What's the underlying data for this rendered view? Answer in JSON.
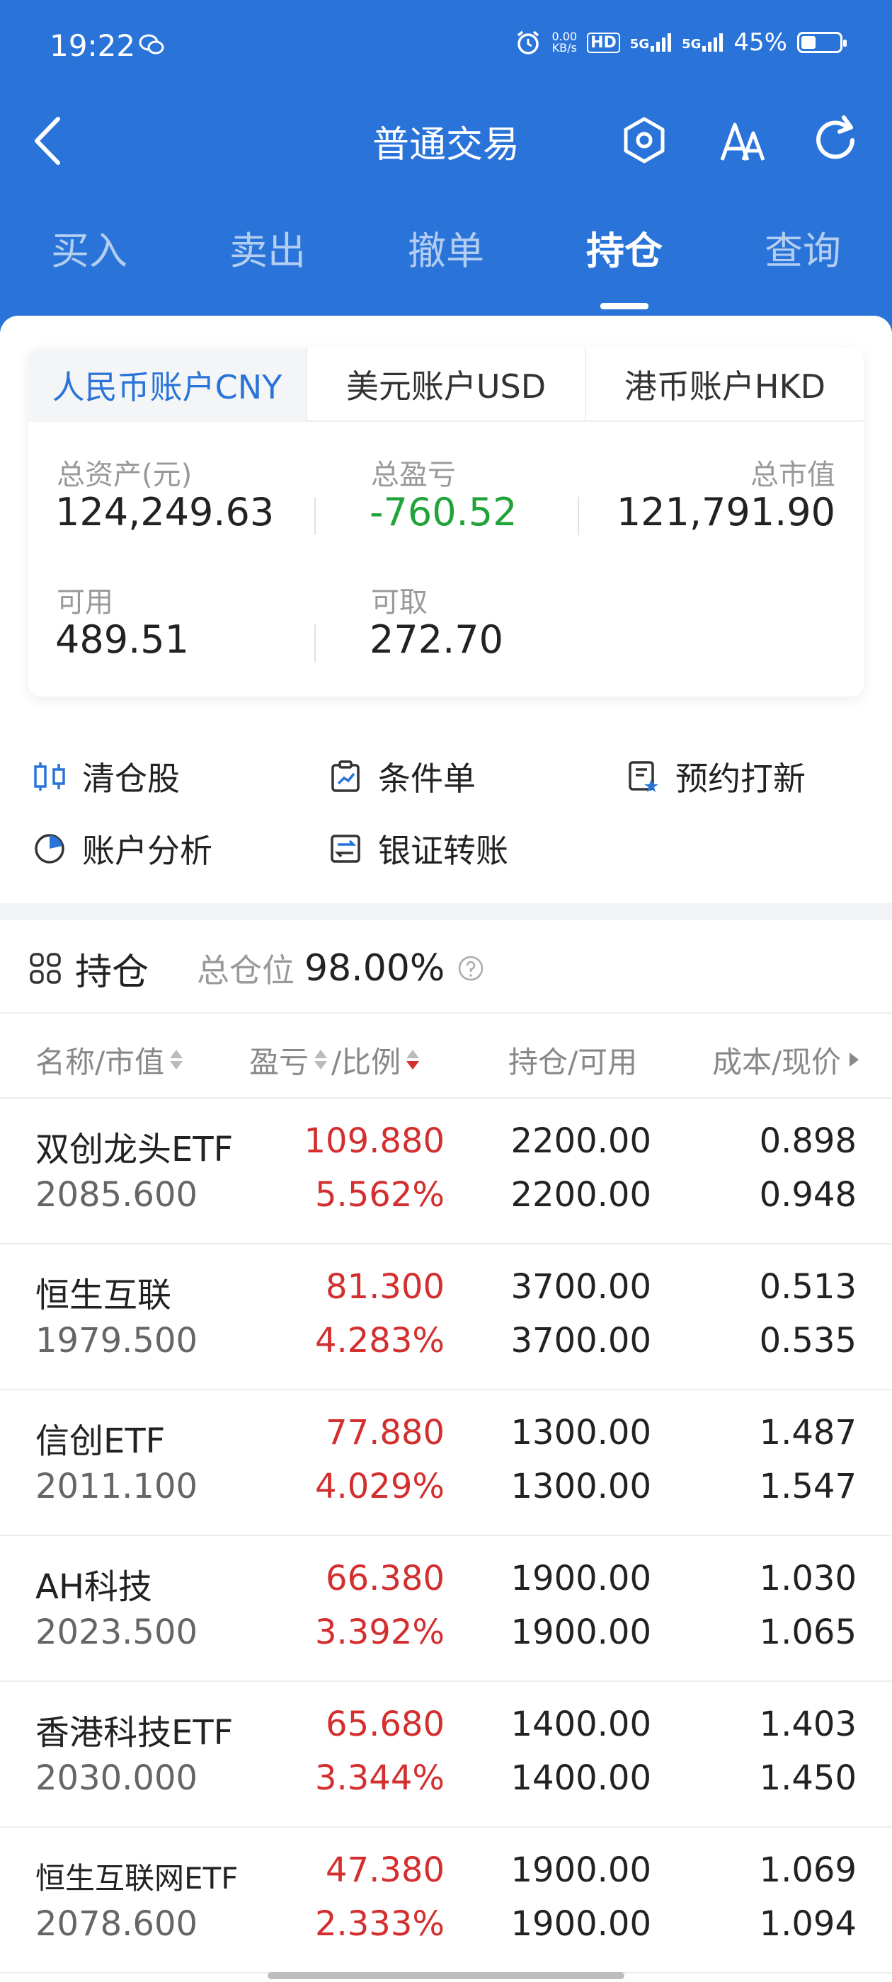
{
  "status_bar": {
    "time": "19:22",
    "net_speed_top": "0.00",
    "net_speed_unit": "KB/s",
    "hd_label": "HD",
    "signal_1": "5G",
    "signal_2": "5G",
    "battery": "45%",
    "battery_level": 0.45
  },
  "nav": {
    "title": "普通交易",
    "icons": [
      "back-chevron-icon",
      "settings-hexagon-icon",
      "font-size-icon",
      "refresh-icon"
    ]
  },
  "tabs": [
    {
      "label": "买入",
      "active": false
    },
    {
      "label": "卖出",
      "active": false
    },
    {
      "label": "撤单",
      "active": false
    },
    {
      "label": "持仓",
      "active": true
    },
    {
      "label": "查询",
      "active": false
    }
  ],
  "accounts": [
    {
      "label": "人民币账户CNY",
      "active": true
    },
    {
      "label": "美元账户USD",
      "active": false
    },
    {
      "label": "港币账户HKD",
      "active": false
    }
  ],
  "metrics": {
    "total_assets_label": "总资产(元)",
    "total_assets": "124,249.63",
    "total_pnl_label": "总盈亏",
    "total_pnl": "-760.52",
    "market_value_label": "总市值",
    "market_value": "121,791.90",
    "available_label": "可用",
    "available": "489.51",
    "withdrawable_label": "可取",
    "withdrawable": "272.70"
  },
  "quick_actions": [
    {
      "label": "清仓股",
      "icon": "clear-position-icon"
    },
    {
      "label": "条件单",
      "icon": "conditional-order-icon"
    },
    {
      "label": "预约打新",
      "icon": "ipo-reserve-icon"
    },
    {
      "label": "账户分析",
      "icon": "pie-chart-icon"
    },
    {
      "label": "银证转账",
      "icon": "transfer-icon"
    }
  ],
  "holdings": {
    "title": "持仓",
    "position_label": "总仓位",
    "position_value": "98.00%",
    "columns": {
      "name": "名称/市值",
      "pnl": "盈亏",
      "ratio": "/比例",
      "position": "持仓/可用",
      "cost": "成本/现价"
    },
    "rows": [
      {
        "name": "双创龙头ETF",
        "market_value": "2085.600",
        "pnl": "109.880",
        "ratio": "5.562%",
        "position": "2200.00",
        "available": "2200.00",
        "cost": "0.898",
        "price": "0.948"
      },
      {
        "name": "恒生互联",
        "market_value": "1979.500",
        "pnl": "81.300",
        "ratio": "4.283%",
        "position": "3700.00",
        "available": "3700.00",
        "cost": "0.513",
        "price": "0.535"
      },
      {
        "name": "信创ETF",
        "market_value": "2011.100",
        "pnl": "77.880",
        "ratio": "4.029%",
        "position": "1300.00",
        "available": "1300.00",
        "cost": "1.487",
        "price": "1.547"
      },
      {
        "name": "AH科技",
        "market_value": "2023.500",
        "pnl": "66.380",
        "ratio": "3.392%",
        "position": "1900.00",
        "available": "1900.00",
        "cost": "1.030",
        "price": "1.065"
      },
      {
        "name": "香港科技ETF",
        "market_value": "2030.000",
        "pnl": "65.680",
        "ratio": "3.344%",
        "position": "1400.00",
        "available": "1400.00",
        "cost": "1.403",
        "price": "1.450"
      },
      {
        "name": "恒生互联网ETF",
        "market_value": "2078.600",
        "pnl": "47.380",
        "ratio": "2.333%",
        "position": "1900.00",
        "available": "1900.00",
        "cost": "1.069",
        "price": "1.094"
      }
    ]
  },
  "colors": {
    "brand_blue": "#2a74d9",
    "profit_red": "#d32f2f",
    "loss_green": "#22a33a"
  }
}
